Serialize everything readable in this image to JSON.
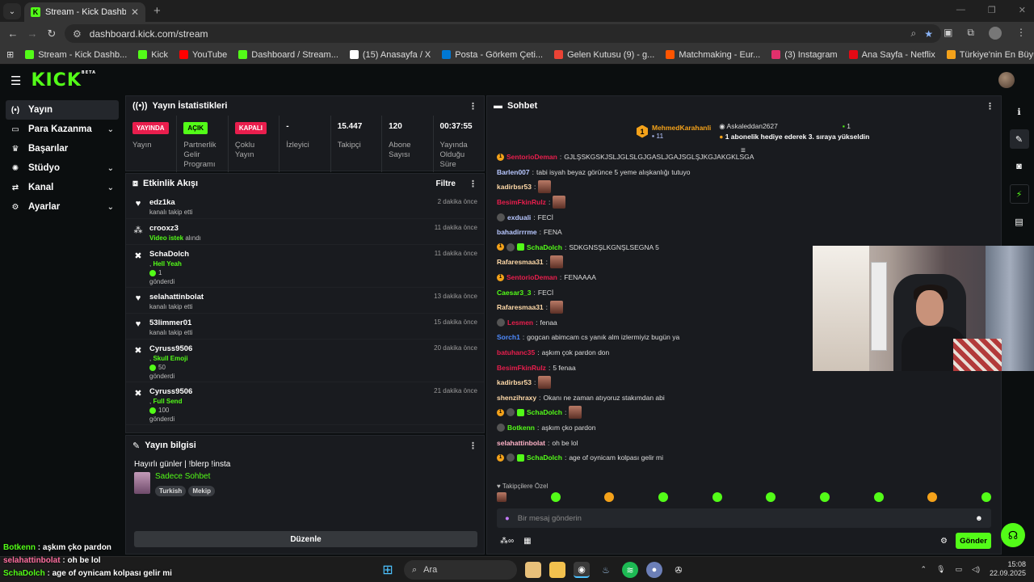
{
  "browser": {
    "tab_title": "Stream - Kick Dashboard",
    "url": "dashboard.kick.com/stream",
    "bookmarks": [
      {
        "label": "Stream - Kick Dashb...",
        "color": "#53fc18"
      },
      {
        "label": "Kick",
        "color": "#53fc18"
      },
      {
        "label": "YouTube",
        "color": "#ff0000"
      },
      {
        "label": "Dashboard / Stream...",
        "color": "#53fc18"
      },
      {
        "label": "(15) Anasayfa / X",
        "color": "#ffffff"
      },
      {
        "label": "Posta - Görkem Çeti...",
        "color": "#0078d4"
      },
      {
        "label": "Gelen Kutusu (9) - g...",
        "color": "#ea4335"
      },
      {
        "label": "Matchmaking - Eur...",
        "color": "#ff5500"
      },
      {
        "label": "(3) Instagram",
        "color": "#e1306c"
      },
      {
        "label": "Ana Sayfa - Netflix",
        "color": "#e50914"
      },
      {
        "label": "Türkiye'nin En Büyü...",
        "color": "#f4a21a"
      }
    ]
  },
  "kick": {
    "logo": "KICK",
    "logo_beta": "BETA",
    "accent": "#53fc18"
  },
  "sidebar": {
    "items": [
      {
        "label": "Yayın",
        "icon": "broadcast-icon",
        "glyph": "(•)",
        "active": true,
        "expandable": false
      },
      {
        "label": "Para Kazanma",
        "icon": "wallet-icon",
        "glyph": "▭",
        "active": false,
        "expandable": true
      },
      {
        "label": "Başarılar",
        "icon": "trophy-icon",
        "glyph": "♛",
        "active": false,
        "expandable": false
      },
      {
        "label": "Stüdyo",
        "icon": "studio-icon",
        "glyph": "✺",
        "active": false,
        "expandable": true
      },
      {
        "label": "Kanal",
        "icon": "channel-icon",
        "glyph": "⇄",
        "active": false,
        "expandable": true
      },
      {
        "label": "Ayarlar",
        "icon": "gear-icon",
        "glyph": "⚙",
        "active": false,
        "expandable": true
      }
    ]
  },
  "stats_panel": {
    "title": "Yayın İstatistikleri",
    "items": [
      {
        "badge": "YAYINDA",
        "badge_color": "red",
        "value": "",
        "caption": "Yayın"
      },
      {
        "badge": "AÇIK",
        "badge_color": "green",
        "value": "",
        "caption": "Partnerlik Gelir Programı"
      },
      {
        "badge": "KAPALI",
        "badge_color": "red",
        "value": "",
        "caption": "Çoklu Yayın"
      },
      {
        "badge": "",
        "badge_color": "",
        "value": "-",
        "caption": "İzleyici"
      },
      {
        "badge": "",
        "badge_color": "",
        "value": "15.447",
        "caption": "Takipçi"
      },
      {
        "badge": "",
        "badge_color": "",
        "value": "120",
        "caption": "Abone Sayısı"
      },
      {
        "badge": "",
        "badge_color": "",
        "value": "00:37:55",
        "caption": "Yayında Olduğu Süre"
      }
    ]
  },
  "activity_panel": {
    "title": "Etkinlik Akışı",
    "filter_label": "Filtre",
    "items": [
      {
        "name": "edz1ka",
        "pre": "",
        "highlight": "",
        "post": "kanalı takip etti",
        "coins": "",
        "coins_label": "",
        "time": "2 dakika önce",
        "type": "follow"
      },
      {
        "name": "crooxz3",
        "pre": "",
        "highlight": "Video istek",
        "post": " alındı",
        "coins": "",
        "coins_label": "",
        "time": "11 dakika önce",
        "type": "request"
      },
      {
        "name": "SchaDolch",
        "pre": ", ",
        "highlight": "Hell Yeah",
        "post": "",
        "coins": "1",
        "coins_label": "gönderdi",
        "time": "11 dakika önce",
        "type": "kicks"
      },
      {
        "name": "selahattinbolat",
        "pre": "",
        "highlight": "",
        "post": "kanalı takip etti",
        "coins": "",
        "coins_label": "",
        "time": "13 dakika önce",
        "type": "follow"
      },
      {
        "name": "53limmer01",
        "pre": "",
        "highlight": "",
        "post": "kanalı takip etti",
        "coins": "",
        "coins_label": "",
        "time": "15 dakika önce",
        "type": "follow"
      },
      {
        "name": "Cyruss9506",
        "pre": ", ",
        "highlight": "Skull Emoji",
        "post": "",
        "coins": "50",
        "coins_label": "gönderdi",
        "time": "20 dakika önce",
        "type": "kicks"
      },
      {
        "name": "Cyruss9506",
        "pre": ", ",
        "highlight": "Full Send",
        "post": "",
        "coins": "100",
        "coins_label": "gönderdi",
        "time": "21 dakika önce",
        "type": "kicks"
      }
    ]
  },
  "stream_info": {
    "title": "Yayın bilgisi",
    "stream_title": "Hayırlı günler | !blerp !insta",
    "category": "Sadece Sohbet",
    "tags": [
      "Turkish",
      "Mekip"
    ],
    "edit_label": "Düzenle"
  },
  "chat": {
    "title": "Sohbet",
    "pinned": [
      {
        "rank": "1",
        "name": "MehmedKarahanli",
        "sub": "11"
      },
      {
        "name": "Askaleddan2627",
        "count": "1",
        "text": "1 abonelik hediye ederek 3. sıraya yükseldin"
      }
    ],
    "messages": [
      {
        "user": "SentorioDeman",
        "color": "#e91e4d",
        "badges": [
          "sub"
        ],
        "text": "GJLŞSKGSKJSLJGLSLGJGASLJGAJSGLŞJKGJAKGKLSGA",
        "emote": false
      },
      {
        "user": "Barlen007",
        "color": "#b8c7ff",
        "badges": [],
        "text": "tabi isyah beyaz görünce 5 yeme alışkanlığı tutuyo",
        "emote": false
      },
      {
        "user": "kadirbsr53",
        "color": "#ffd9a8",
        "badges": [],
        "text": "",
        "emote": true
      },
      {
        "user": "BesimFkinRulz",
        "color": "#e91e4d",
        "badges": [],
        "text": "",
        "emote": true
      },
      {
        "user": "exduali",
        "color": "#b8c7ff",
        "badges": [
          "av"
        ],
        "text": "FECİ",
        "emote": false
      },
      {
        "user": "bahadirrrme",
        "color": "#b8c7ff",
        "badges": [],
        "text": "FENA",
        "emote": false
      },
      {
        "user": "SchaDolch",
        "color": "#53fc18",
        "badges": [
          "sub",
          "av",
          "gift"
        ],
        "text": "SDKGNSŞLKGNŞLSEGNA 5",
        "emote": false
      },
      {
        "user": "Rafaresmaa31",
        "color": "#ffd9a8",
        "badges": [],
        "text": "",
        "emote": true
      },
      {
        "user": "SentorioDeman",
        "color": "#e91e4d",
        "badges": [
          "sub"
        ],
        "text": "FENAAAA",
        "emote": false
      },
      {
        "user": "Caesar3_3",
        "color": "#53fc18",
        "badges": [],
        "text": "FECİ",
        "emote": false
      },
      {
        "user": "Rafaresmaa31",
        "color": "#ffd9a8",
        "badges": [],
        "text": "",
        "emote": true
      },
      {
        "user": "Lesmen",
        "color": "#e91e4d",
        "badges": [
          "av"
        ],
        "text": "fenaa",
        "emote": false
      },
      {
        "user": "Sorch1",
        "color": "#4f8bff",
        "badges": [],
        "text": "gogcan abimcam cs yanık alm izlermiyiz bugün ya",
        "emote": false
      },
      {
        "user": "batuhanc35",
        "color": "#e91e4d",
        "badges": [],
        "text": "aşkım çok pardon don",
        "emote": false
      },
      {
        "user": "BesimFkinRulz",
        "color": "#e91e4d",
        "badges": [],
        "text": "5 fenaa",
        "emote": false
      },
      {
        "user": "kadirbsr53",
        "color": "#ffd9a8",
        "badges": [],
        "text": "",
        "emote": true
      },
      {
        "user": "shenzihraxy",
        "color": "#ffd9a8",
        "badges": [],
        "text": "Okanı ne zaman atıyoruz stakımdan abi",
        "emote": false
      },
      {
        "user": "SchaDolch",
        "color": "#53fc18",
        "badges": [
          "sub",
          "av",
          "gift"
        ],
        "text": "",
        "emote": true
      },
      {
        "user": "Botkenn",
        "color": "#53fc18",
        "badges": [
          "av"
        ],
        "text": "aşkım çko pardon",
        "emote": false
      },
      {
        "user": "selahattinbolat",
        "color": "#ffb3c8",
        "badges": [],
        "text": "oh be lol",
        "emote": false
      },
      {
        "user": "SchaDolch",
        "color": "#53fc18",
        "badges": [
          "sub",
          "av",
          "gift"
        ],
        "text": "age of oynicam kolpası gelir mi",
        "emote": false
      }
    ],
    "followers_only_label": "Takipçilere Özel",
    "input_placeholder": "Bir mesaj gönderin",
    "send_label": "Gönder"
  },
  "overlay": [
    {
      "user": "Botkenn",
      "color": "#53fc18",
      "text": "aşkım çko pardon"
    },
    {
      "user": "selahattinbolat",
      "color": "#ff6fa0",
      "text": "oh be lol"
    },
    {
      "user": "SchaDolch",
      "color": "#53fc18",
      "text": "age of oynicam kolpası gelir mi"
    }
  ],
  "taskbar": {
    "search_label": "Ara",
    "time": "15:08",
    "date": "22.09.2025"
  }
}
